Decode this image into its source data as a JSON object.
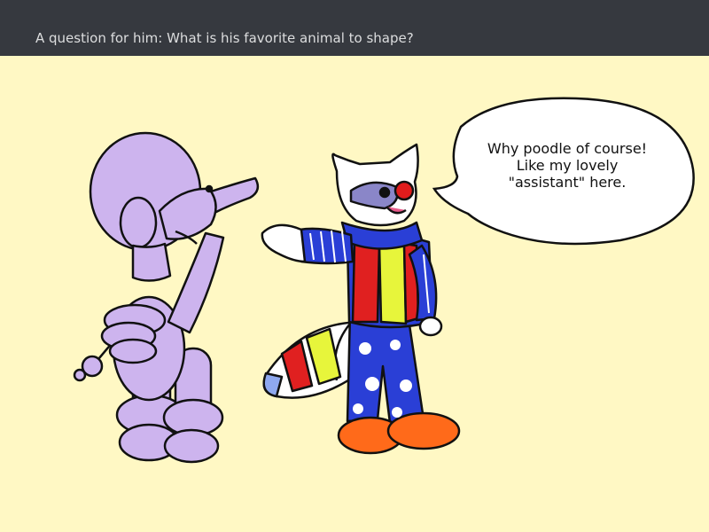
{
  "header": {
    "title": "A question for him: What is his favorite animal to shape?"
  },
  "bubble": {
    "lines": [
      "Why poodle of course!",
      "Like my lovely",
      "\"assistant\" here."
    ]
  },
  "colors": {
    "header_bg": "#36393f",
    "header_text": "#dcddde",
    "scene_bg": "#fff8c4",
    "poodle_balloon": "#cdb4ee",
    "clown_body": "#2a3fd6",
    "nose": "#e01c1c",
    "shoes": "#ff6a1a"
  }
}
